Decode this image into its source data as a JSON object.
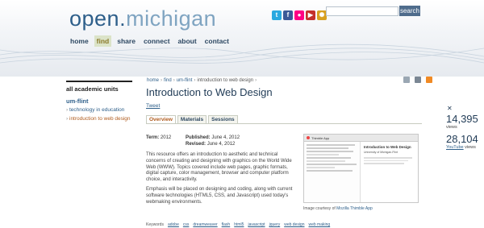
{
  "site": {
    "logo_part1": "open.",
    "logo_part2": "michigan"
  },
  "social_icons": [
    {
      "icon": "twitter-icon",
      "glyph": "t",
      "color": "#2aa9e0"
    },
    {
      "icon": "facebook-icon",
      "glyph": "f",
      "color": "#3b5998"
    },
    {
      "icon": "flickr-icon",
      "glyph": "●",
      "color": "#ff0084"
    },
    {
      "icon": "youtube-icon",
      "glyph": "▶",
      "color": "#c4302b"
    },
    {
      "icon": "podcast-icon",
      "glyph": "✺",
      "color": "#d8a020"
    }
  ],
  "search": {
    "placeholder": "",
    "button_label": "search"
  },
  "nav": [
    "home",
    "find",
    "share",
    "connect",
    "about",
    "contact"
  ],
  "sidebar": {
    "title": "all academic units",
    "unit": "um-flint",
    "items": [
      "technology in education",
      "introduction to web design"
    ]
  },
  "breadcrumb": [
    "home",
    "find",
    "um-flint",
    "introduction to web design"
  ],
  "page": {
    "title": "Introduction to Web Design",
    "tweet": "Tweet",
    "tabs": [
      "Overview",
      "Materials",
      "Sessions"
    ],
    "term_label": "Term:",
    "term": "2012",
    "published_label": "Published:",
    "published": "June 4, 2012",
    "revised_label": "Revised:",
    "revised": "June 4, 2012",
    "paragraphs": [
      "This resource offers an introduction to aesthetic and technical concerns of creating and designing with graphics on the World Wide Web (WWW). Topics covered include web pages, graphic formats, digital capture, color management, browser and computer platform choice, and interactivity.",
      "Emphasis will be placed on designing and coding, along with current software technologies (HTML5, CSS, and Javascript) used today's webmaking environments."
    ],
    "caption_prefix": "Image courtesy of",
    "caption_link": "Mozilla Thimble App",
    "thumb_title": "Thimble App",
    "thumb_heading": "Introduction to Web Design",
    "thumb_sub": "University of Michigan-Flint",
    "keywords_label": "Keywords",
    "keywords": [
      "adobe",
      "css",
      "dreamweaver",
      "flash",
      "html5",
      "javascript",
      "jquery",
      "web design",
      "web making"
    ]
  },
  "stats": [
    {
      "number": "14,395",
      "label": "views"
    },
    {
      "number": "28,104",
      "label_link": "YouTube",
      "label_suffix": "views"
    }
  ],
  "colors": {
    "accent": "#2e5f8a",
    "active_tab": "#b05c1e",
    "nav_active_bg": "#dbe3c8"
  }
}
